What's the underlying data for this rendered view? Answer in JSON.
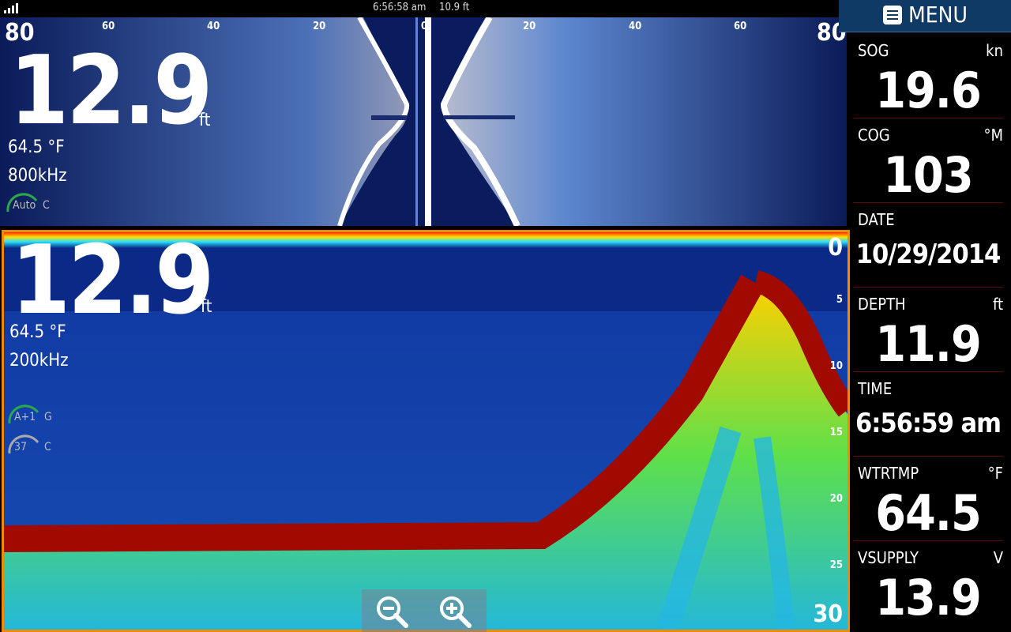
{
  "status_bar": {
    "clock": "6:56:58 am",
    "depth": "10.9 ft"
  },
  "sidescan": {
    "range_labels": [
      "80",
      "60",
      "40",
      "20",
      "0",
      "20",
      "40",
      "60",
      "80"
    ],
    "depth": "12.9",
    "depth_unit": "ft",
    "temperature": "64.5 °F",
    "frequency": "800kHz",
    "gauge_label": "Auto",
    "gauge_suffix": "C"
  },
  "sonar": {
    "depth": "12.9",
    "depth_unit": "ft",
    "temperature": "64.5 °F",
    "frequency": "200kHz",
    "gain_gauge": {
      "label": "A+1",
      "suffix": "G"
    },
    "contrast_gauge": {
      "label": "37",
      "suffix": "C"
    },
    "depth_scale": [
      "0",
      "5",
      "10",
      "15",
      "20",
      "25",
      "30"
    ]
  },
  "menu": {
    "label": "MENU"
  },
  "data_tiles": [
    {
      "name": "SOG",
      "unit": "kn",
      "value": "19.6"
    },
    {
      "name": "COG",
      "unit": "°M",
      "value": "103"
    },
    {
      "name": "DATE",
      "unit": "",
      "value": "10/29/2014"
    },
    {
      "name": "DEPTH",
      "unit": "ft",
      "value": "11.9"
    },
    {
      "name": "TIME",
      "unit": "",
      "value": "6:56:59 am"
    },
    {
      "name": "WTRTMP",
      "unit": "°F",
      "value": "64.5"
    },
    {
      "name": "VSUPPLY",
      "unit": "V",
      "value": "13.9"
    }
  ],
  "colors": {
    "panel_border": "#f08a00",
    "sonar_bg": "#0b2a87",
    "bottom": "#a00a00",
    "menu_bg": "#0f3a66"
  }
}
